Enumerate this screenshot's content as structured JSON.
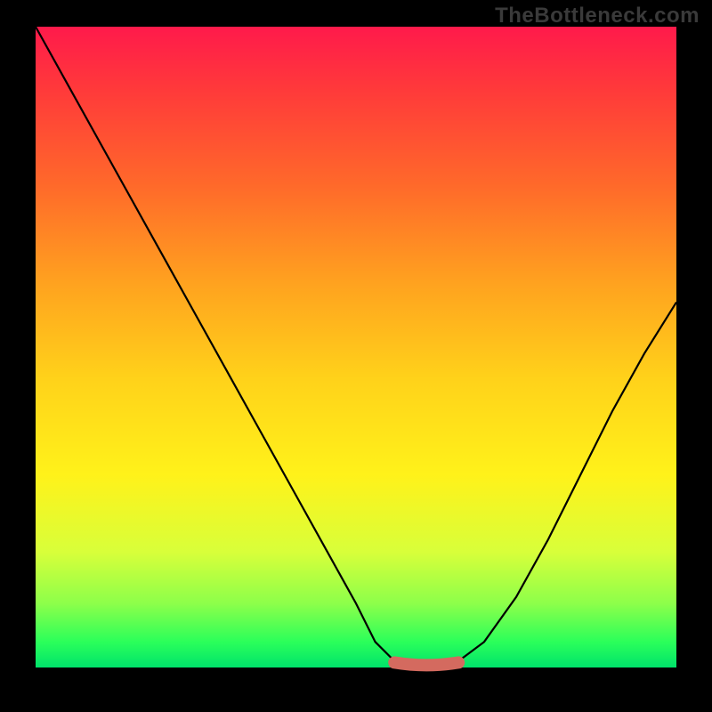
{
  "watermark": "TheBottleneck.com",
  "chart_data": {
    "type": "line",
    "title": "",
    "xlabel": "",
    "ylabel": "",
    "xlim": [
      0,
      100
    ],
    "ylim": [
      0,
      100
    ],
    "series": [
      {
        "name": "curve",
        "x": [
          0,
          5,
          10,
          15,
          20,
          25,
          30,
          35,
          40,
          45,
          50,
          53,
          56,
          60,
          63,
          66,
          70,
          75,
          80,
          85,
          90,
          95,
          100
        ],
        "y": [
          100,
          91,
          82,
          73,
          64,
          55,
          46,
          37,
          28,
          19,
          10,
          4,
          1,
          0,
          0,
          1,
          4,
          11,
          20,
          30,
          40,
          49,
          57
        ]
      }
    ],
    "highlight_flat": {
      "x_start": 56,
      "x_end": 66,
      "y": 0.5
    },
    "colors": {
      "curve": "#000000",
      "highlight": "#d46a5f",
      "gradient_top": "#ff1a4b",
      "gradient_bottom": "#00e36b",
      "frame": "#000000",
      "watermark": "#3a3a3a"
    }
  }
}
